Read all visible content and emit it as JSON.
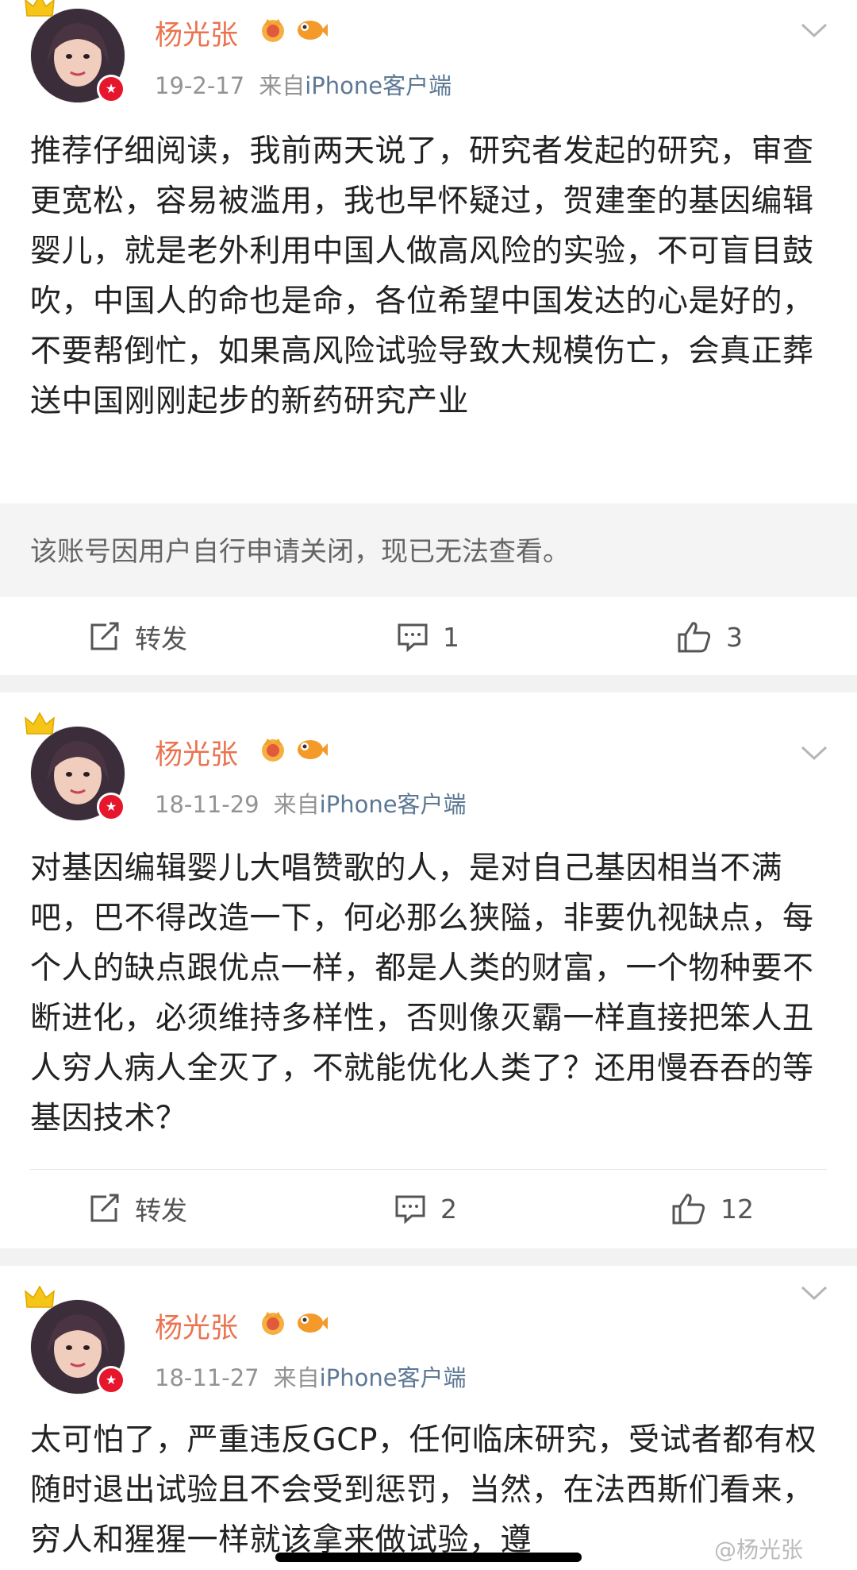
{
  "posts": [
    {
      "username": "杨光张",
      "date": "19-2-17",
      "from": "来自",
      "source": "iPhone客户端",
      "content": "推荐仔细阅读，我前两天说了，研究者发起的研究，审查更宽松，容易被滥用，我也早怀疑过，贺建奎的基因编辑婴儿，就是老外利用中国人做高风险的实验，不可盲目鼓吹，中国人的命也是命，各位希望中国发达的心是好的，不要帮倒忙，如果高风险试验导致大规模伤亡，会真正葬送中国刚刚起步的新药研究产业",
      "quote": "该账号因用户自行申请关闭，现已无法查看。",
      "repost_label": "转发",
      "comments": "1",
      "likes": "3"
    },
    {
      "username": "杨光张",
      "date": "18-11-29",
      "from": "来自",
      "source": "iPhone客户端",
      "content": "对基因编辑婴儿大唱赞歌的人，是对自己基因相当不满吧，巴不得改造一下，何必那么狭隘，非要仇视缺点，每个人的缺点跟优点一样，都是人类的财富，一个物种要不断进化，必须维持多样性，否则像灭霸一样直接把笨人丑人穷人病人全灭了，不就能优化人类了？还用慢吞吞的等基因技术？",
      "repost_label": "转发",
      "comments": "2",
      "likes": "12"
    },
    {
      "username": "杨光张",
      "date": "18-11-27",
      "from": "来自",
      "source": "iPhone客户端",
      "content": "太可怕了，严重违反GCP，任何临床研究，受试者都有权随时退出试验且不会受到惩罚，当然，在法西斯们看来，穷人和猩猩一样就该拿来做试验，遵"
    }
  ],
  "watermark": "@杨光张",
  "colors": {
    "username": "#eb7350",
    "source": "#5d7895",
    "meta": "#939393",
    "verified": "#e6162d"
  },
  "icons": [
    "crown-icon",
    "vip-crown-badge-icon",
    "fish-badge-icon",
    "verified-badge-icon",
    "chevron-down-icon",
    "repost-icon",
    "comment-icon",
    "like-icon"
  ]
}
